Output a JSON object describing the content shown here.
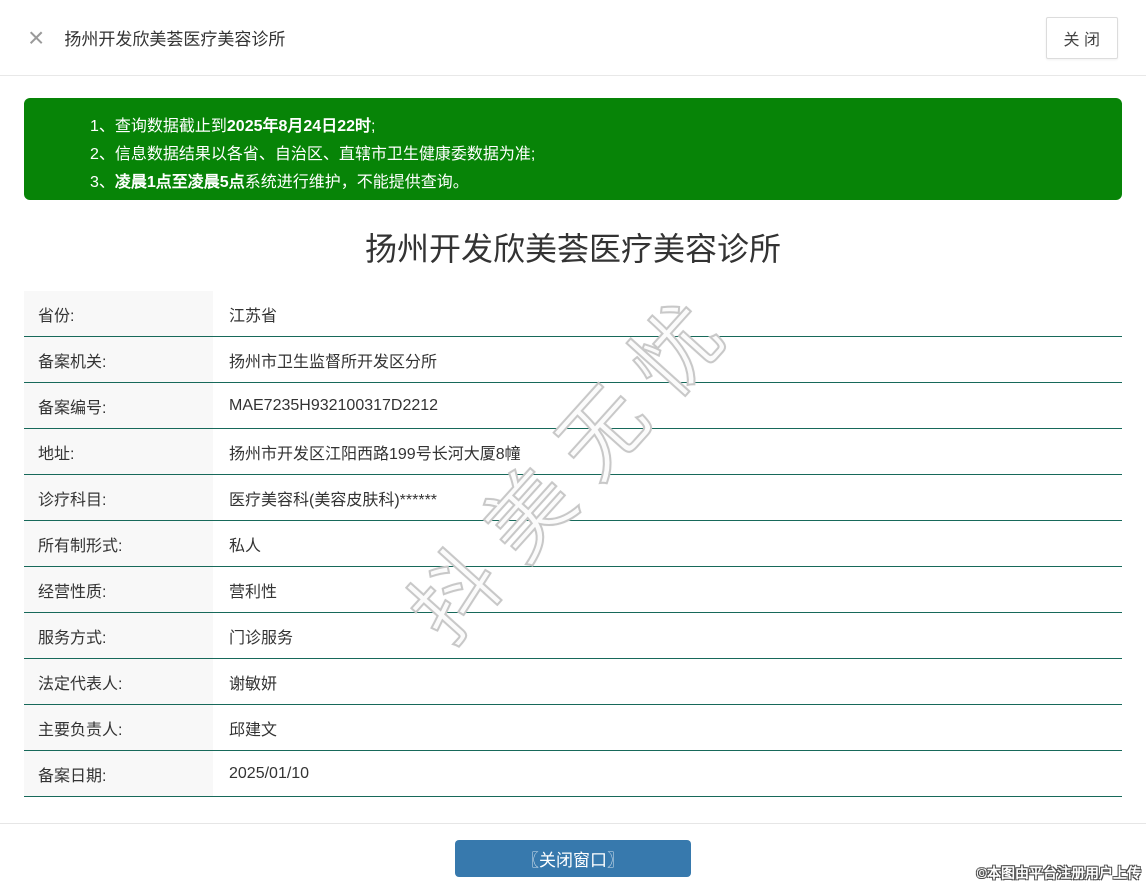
{
  "header": {
    "close_icon": "×",
    "title": "扬州开发欣美荟医疗美容诊所",
    "close_button": "关 闭"
  },
  "notice": {
    "line1": {
      "normal1": "1、查询数据截止到",
      "bold": "2025年8月24日22时",
      "normal2": ";"
    },
    "line2": {
      "normal1": "2、信息数据结果以各省、自治区、直辖市卫生健康委数据为准;",
      "bold": "",
      "normal2": ""
    },
    "line3": {
      "normal1": "3、",
      "bold": "凌晨1点至凌晨5点",
      "normal2": "系统进行维护，不能提供查询。"
    }
  },
  "main": {
    "title": "扬州开发欣美荟医疗美容诊所"
  },
  "table": {
    "rows": [
      {
        "label": "省份:",
        "value": "江苏省"
      },
      {
        "label": "备案机关:",
        "value": "扬州市卫生监督所开发区分所"
      },
      {
        "label": "备案编号:",
        "value": "MAE7235H932100317D2212"
      },
      {
        "label": "地址:",
        "value": "扬州市开发区江阳西路199号长河大厦8幢"
      },
      {
        "label": "诊疗科目:",
        "value": "医疗美容科(美容皮肤科)******"
      },
      {
        "label": "所有制形式:",
        "value": "私人"
      },
      {
        "label": "经营性质:",
        "value": "营利性"
      },
      {
        "label": "服务方式:",
        "value": "门诊服务"
      },
      {
        "label": "法定代表人:",
        "value": "谢敏妍"
      },
      {
        "label": "主要负责人:",
        "value": "邱建文"
      },
      {
        "label": "备案日期:",
        "value": "2025/01/10"
      }
    ]
  },
  "footer": {
    "button_label": "〖关闭窗口〗"
  },
  "watermark": {
    "center": "抖美无忧",
    "corner": "©本图由平台注册用户上传"
  },
  "colors": {
    "notice_green": "#078407",
    "button_blue": "#3779ad",
    "table_border_teal": "#17695a"
  }
}
